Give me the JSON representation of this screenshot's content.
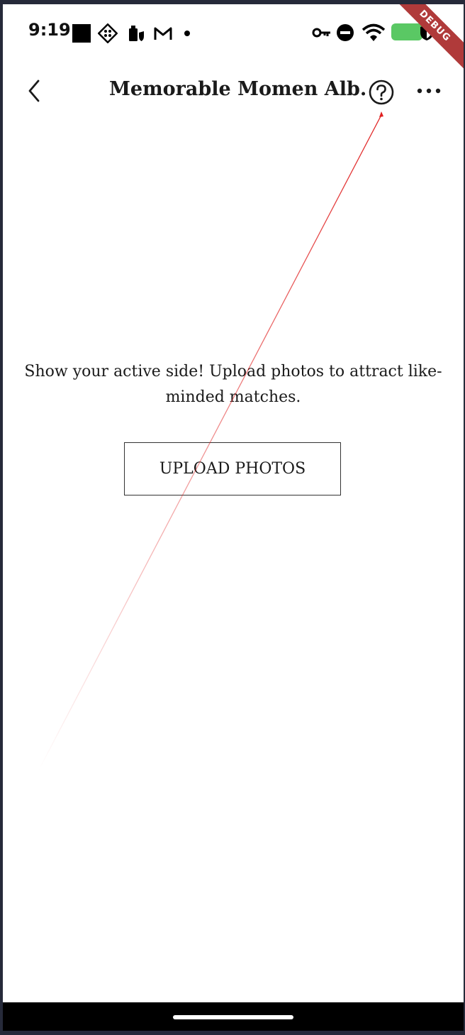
{
  "status_bar": {
    "time": "9:19",
    "debug_label": "DEBUG"
  },
  "app_bar": {
    "title": "Memorable Momen Alb..",
    "back_icon": "chevron-left-icon",
    "help_icon": "question-circle-icon",
    "more_icon": "more-horizontal-icon"
  },
  "content": {
    "prompt": "Show your active side! Upload photos to attract like-minded matches.",
    "upload_button_label": "UPLOAD PHOTOS"
  },
  "colors": {
    "background": "#ffffff",
    "text": "#1a1a1a",
    "debug_ribbon": "#b03a3a",
    "battery": "#5ac864",
    "pointer_line": "#e02020"
  }
}
